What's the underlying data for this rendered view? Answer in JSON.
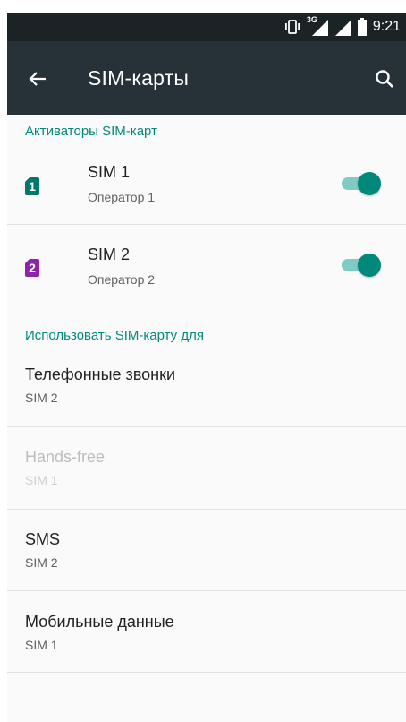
{
  "status_bar": {
    "time": "9:21",
    "network_type": "3G",
    "icons": [
      "vibrate-icon",
      "signal-3g-icon",
      "signal-icon",
      "battery-icon"
    ]
  },
  "app_bar": {
    "title": "SIM-карты",
    "back_icon": "arrow-back-icon",
    "search_icon": "search-icon"
  },
  "activators": {
    "header": "Активаторы SIM-карт",
    "sims": [
      {
        "badge": "1",
        "name": "SIM 1",
        "operator": "Оператор 1",
        "enabled": true,
        "color": "#00796b"
      },
      {
        "badge": "2",
        "name": "SIM 2",
        "operator": "Оператор 2",
        "enabled": true,
        "color": "#8e24aa"
      }
    ]
  },
  "usage": {
    "header": "Использовать SIM-карту для",
    "items": [
      {
        "title": "Телефонные звонки",
        "value": "SIM 2",
        "enabled": true
      },
      {
        "title": "Hands-free",
        "value": "SIM 1",
        "enabled": false
      },
      {
        "title": "SMS",
        "value": "SIM 2",
        "enabled": true
      },
      {
        "title": "Мобильные данные",
        "value": "SIM 1",
        "enabled": true
      }
    ]
  },
  "colors": {
    "accent": "#00897b",
    "accent_light": "#80cbc4",
    "app_bar": "#263238",
    "status_bar": "#1b2327"
  }
}
